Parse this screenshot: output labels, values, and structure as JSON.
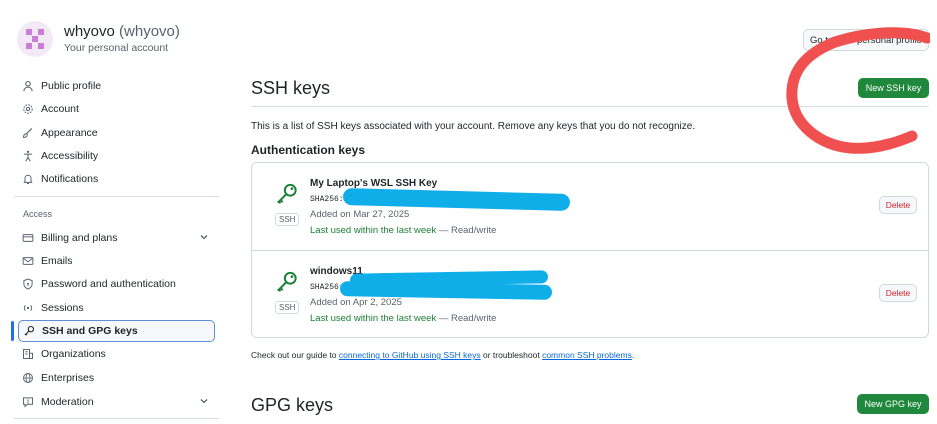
{
  "account": {
    "display_name": "whyovo",
    "login": "(whyovo)",
    "subtitle": "Your personal account",
    "profile_button": "Go to your personal profile"
  },
  "sidebar": {
    "items_top": [
      {
        "label": "Public profile",
        "icon": "person-icon"
      },
      {
        "label": "Account",
        "icon": "gear-icon"
      },
      {
        "label": "Appearance",
        "icon": "paintbrush-icon"
      },
      {
        "label": "Accessibility",
        "icon": "accessibility-icon"
      },
      {
        "label": "Notifications",
        "icon": "bell-icon"
      }
    ],
    "access_heading": "Access",
    "items_access": [
      {
        "label": "Billing and plans",
        "icon": "credit-card-icon"
      },
      {
        "label": "Emails",
        "icon": "mail-icon"
      },
      {
        "label": "Password and authentication",
        "icon": "shield-lock-icon"
      },
      {
        "label": "Sessions",
        "icon": "broadcast-icon"
      },
      {
        "label": "SSH and GPG keys",
        "icon": "key-icon"
      },
      {
        "label": "Organizations",
        "icon": "organization-icon"
      },
      {
        "label": "Enterprises",
        "icon": "globe-icon"
      },
      {
        "label": "Moderation",
        "icon": "report-icon"
      }
    ]
  },
  "ssh": {
    "title": "SSH keys",
    "new_button": "New SSH key",
    "description": "This is a list of SSH keys associated with your account. Remove any keys that you do not recognize.",
    "auth_heading": "Authentication keys",
    "keys": [
      {
        "title": "My Laptop's WSL SSH Key",
        "fingerprint": "SHA256:",
        "added": "Added on Mar 27, 2025",
        "used_green": "Last used within the last week",
        "used_rest": " — Read/write",
        "tag": "SSH",
        "delete": "Delete"
      },
      {
        "title": "windows11",
        "fingerprint": "SHA256:",
        "added": "Added on Apr 2, 2025",
        "used_green": "Last used within the last week",
        "used_rest": " — Read/write",
        "tag": "SSH",
        "delete": "Delete"
      }
    ],
    "guide": {
      "prefix": "Check out our guide to ",
      "link1": "connecting to GitHub using SSH keys",
      "middle": " or troubleshoot ",
      "link2": "common SSH problems",
      "suffix": "."
    }
  },
  "gpg": {
    "title": "GPG keys",
    "new_button": "New GPG key"
  },
  "colors": {
    "accent_blue": "#0969da",
    "primary_green": "#1f883d",
    "danger_red": "#d1242f",
    "scribble_red": "#f0504f",
    "redaction_blue": "#10aee8"
  }
}
